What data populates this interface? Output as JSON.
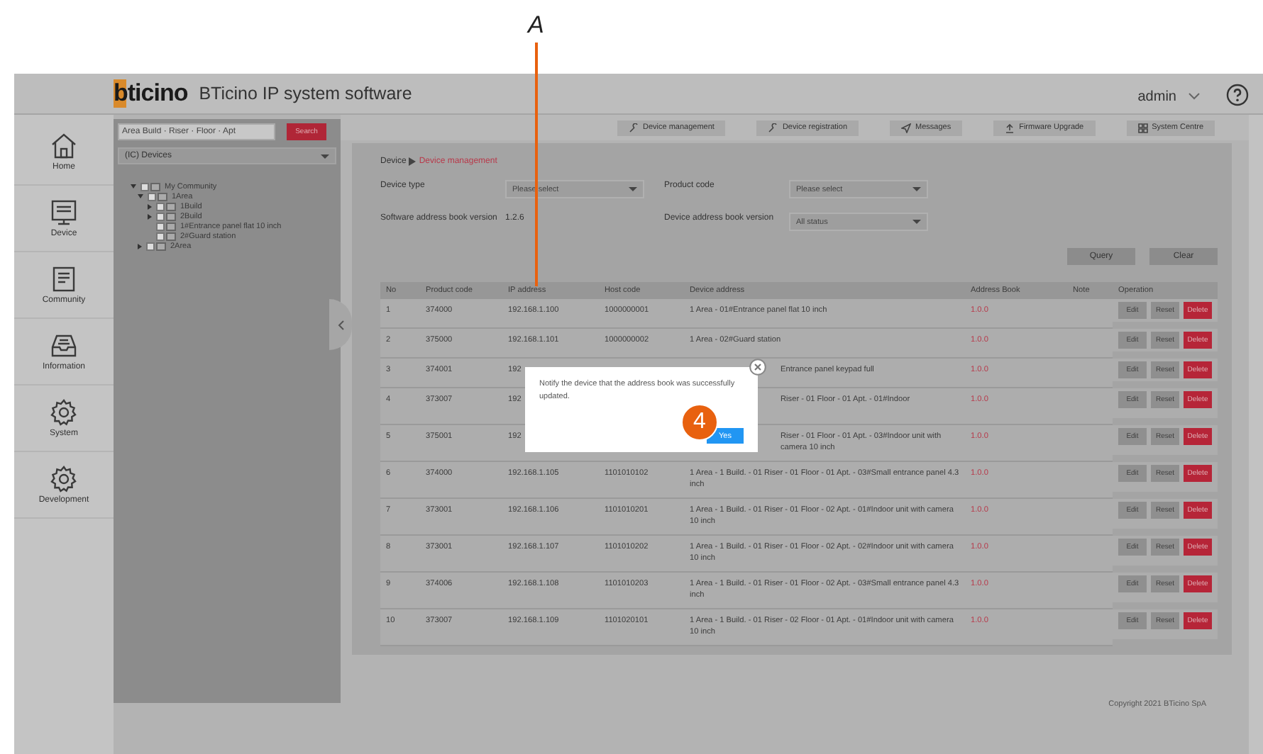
{
  "annotation": {
    "label": "A"
  },
  "header": {
    "logo": "bticino",
    "title": "BTicino IP system software",
    "user": "admin"
  },
  "nav": [
    {
      "label": "Home",
      "kind": "home"
    },
    {
      "label": "Device",
      "kind": "monitor"
    },
    {
      "label": "Community",
      "kind": "document"
    },
    {
      "label": "Information",
      "kind": "inbox"
    },
    {
      "label": "System",
      "kind": "gear"
    },
    {
      "label": "Development",
      "kind": "gear"
    }
  ],
  "tree": {
    "search_placeholder": "Area Build · Riser · Floor · Apt",
    "search_button": "Search",
    "filter": "(IC) Devices",
    "nodes": [
      {
        "label": "My Community",
        "expanded": true,
        "checked": false,
        "children": [
          {
            "label": "1Area",
            "expanded": true,
            "checked": false,
            "children": [
              {
                "label": "1Build",
                "expanded": false,
                "checked": false
              },
              {
                "label": "2Build",
                "expanded": false,
                "checked": false
              },
              {
                "label": "1#Entrance panel flat 10 inch",
                "checked": false
              },
              {
                "label": "2#Guard station",
                "checked": false
              }
            ]
          },
          {
            "label": "2Area",
            "expanded": false,
            "checked": false
          }
        ]
      }
    ]
  },
  "tabs": [
    {
      "label": "Device management",
      "kind": "wrench"
    },
    {
      "label": "Device registration",
      "kind": "wrench"
    },
    {
      "label": "Messages",
      "kind": "send"
    },
    {
      "label": "Firmware Upgrade",
      "kind": "upload"
    },
    {
      "label": "System Centre",
      "kind": "grid"
    }
  ],
  "breadcrumb": [
    "Device",
    "Device management"
  ],
  "form": [
    {
      "label": "Device type",
      "kind": "select",
      "placeholder": "Please select"
    },
    {
      "label": "Product code",
      "kind": "select",
      "placeholder": "Please select"
    },
    {
      "label": "Software address book version",
      "kind": "text",
      "value": "1.2.6"
    },
    {
      "label": "Device address book version",
      "kind": "select",
      "value": "All status"
    }
  ],
  "buttons": [
    "Query",
    "Clear"
  ],
  "table": {
    "columns": [
      "No",
      "Product code",
      "IP address",
      "Host code",
      "Device address",
      "Address Book",
      "Note",
      "Operation"
    ],
    "rows": [
      {
        "no": "1",
        "product": "374000",
        "ip": "192.168.1.100",
        "host": "1000000001",
        "address": "1 Area - 01#Entrance panel flat 10 inch",
        "book": "1.0.0",
        "actions": [
          "Edit",
          "Reset",
          "Delete"
        ]
      },
      {
        "no": "2",
        "product": "375000",
        "ip": "192.168.1.101",
        "host": "1000000002",
        "address": "1 Area - 02#Guard station",
        "book": "1.0.0",
        "actions": [
          "Edit",
          "Reset",
          "Delete"
        ]
      },
      {
        "no": "3",
        "product": "374001",
        "ip": "192",
        "address": "Entrance panel keypad full",
        "book": "1.0.0",
        "actions": [
          "Edit",
          "Reset",
          "Delete"
        ]
      },
      {
        "no": "4",
        "product": "373007",
        "ip": "192",
        "address": "Riser - 01 Floor - 01 Apt. - 01#Indoor",
        "book": "1.0.0",
        "actions": [
          "Edit",
          "Reset",
          "Delete"
        ]
      },
      {
        "no": "5",
        "product": "375001",
        "ip": "192",
        "address": "Riser - 01 Floor - 01 Apt. - 03#Indoor unit with camera 10 inch",
        "book": "1.0.0",
        "actions": [
          "Edit",
          "Reset",
          "Delete"
        ]
      },
      {
        "no": "6",
        "product": "374000",
        "ip": "192.168.1.105",
        "host": "1101010102",
        "address": "1 Area - 1 Build. - 01 Riser - 01 Floor - 01 Apt. - 03#Small entrance panel 4.3 inch",
        "book": "1.0.0",
        "actions": [
          "Edit",
          "Reset",
          "Delete"
        ]
      },
      {
        "no": "7",
        "product": "373001",
        "ip": "192.168.1.106",
        "host": "1101010201",
        "address": "1 Area - 1 Build. - 01 Riser - 01 Floor - 02 Apt. - 01#Indoor unit with camera 10 inch",
        "book": "1.0.0",
        "actions": [
          "Edit",
          "Reset",
          "Delete"
        ]
      },
      {
        "no": "8",
        "product": "373001",
        "ip": "192.168.1.107",
        "host": "1101010202",
        "address": "1 Area - 1 Build. - 01 Riser - 01 Floor - 02 Apt. - 02#Indoor unit with camera 10 inch",
        "book": "1.0.0",
        "actions": [
          "Edit",
          "Reset",
          "Delete"
        ]
      },
      {
        "no": "9",
        "product": "374006",
        "ip": "192.168.1.108",
        "host": "1101010203",
        "address": "1 Area - 1 Build. - 01 Riser - 01 Floor - 02 Apt. - 03#Small entrance panel 4.3 inch",
        "book": "1.0.0",
        "actions": [
          "Edit",
          "Reset",
          "Delete"
        ]
      },
      {
        "no": "10",
        "product": "373007",
        "ip": "192.168.1.109",
        "host": "1101020101",
        "address": "1 Area - 1 Build. - 01 Riser - 02 Floor - 01 Apt. - 01#Indoor unit with camera 10 inch",
        "book": "1.0.0",
        "actions": [
          "Edit",
          "Reset",
          "Delete"
        ]
      }
    ]
  },
  "dialog": {
    "message": "Notify the device that the address book was successfully updated.",
    "button": "Yes",
    "step": "4"
  },
  "footer": "Copyright 2021 BTicino SpA"
}
